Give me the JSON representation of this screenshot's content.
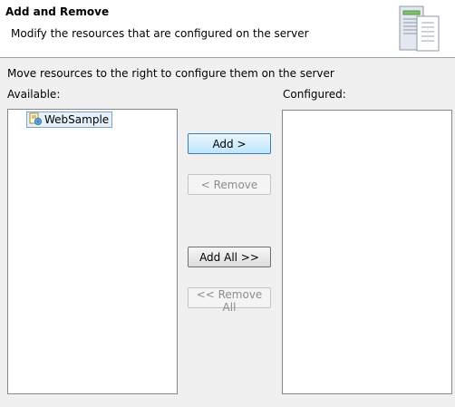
{
  "header": {
    "title": "Add and Remove",
    "description": "Modify the resources that are configured on the server",
    "icon": "server-icon"
  },
  "instructions": "Move resources to the right to configure them on the server",
  "available": {
    "label": "Available:",
    "items": [
      {
        "label": "WebSample",
        "icon": "web-project-icon",
        "selected": true
      }
    ]
  },
  "configured": {
    "label": "Configured:",
    "items": []
  },
  "buttons": {
    "add": "Add >",
    "remove": "< Remove",
    "add_all": "Add All >>",
    "remove_all": "<< Remove All"
  },
  "colors": {
    "selection_fill": "#e5f0fb",
    "selection_border": "#7da2ce",
    "disabled_text": "#8d8d8d"
  }
}
